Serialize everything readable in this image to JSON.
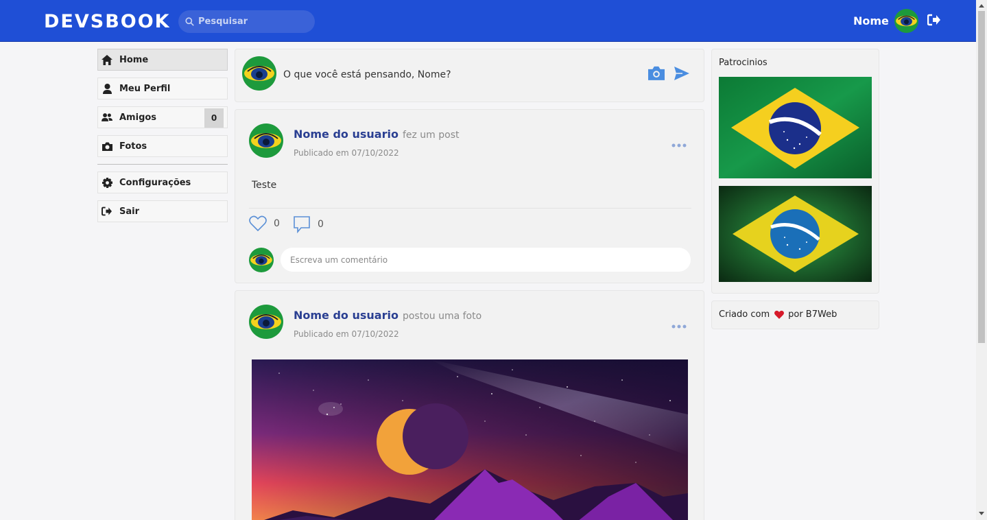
{
  "header": {
    "logo": "DEVSBOOK",
    "search_placeholder": "Pesquisar",
    "user_name": "Nome"
  },
  "menu": {
    "items": [
      {
        "label": "Home",
        "icon": "home-icon",
        "active": true
      },
      {
        "label": "Meu Perfil",
        "icon": "user-icon"
      },
      {
        "label": "Amigos",
        "icon": "users-icon",
        "badge": "0"
      },
      {
        "label": "Fotos",
        "icon": "camera-icon"
      },
      {
        "label": "Configurações",
        "icon": "gear-icon"
      },
      {
        "label": "Sair",
        "icon": "logout-icon"
      }
    ]
  },
  "compose": {
    "placeholder": "O que você está pensando, Nome?"
  },
  "posts": [
    {
      "user": "Nome do usuario",
      "action": "fez um post",
      "date": "Publicado em 07/10/2022",
      "text": "Teste",
      "likes": "0",
      "comments": "0",
      "comment_placeholder": "Escreva um comentário"
    },
    {
      "user": "Nome do usuario",
      "action": "postou uma foto",
      "date": "Publicado em 07/10/2022"
    }
  ],
  "sidebar": {
    "sponsors_title": "Patrocinios",
    "credits_prefix": "Criado com",
    "credits_suffix": "por B7Web"
  },
  "colors": {
    "header": "#1f4fd6",
    "username": "#2a3f92",
    "icon_blue": "#4a8de0"
  }
}
